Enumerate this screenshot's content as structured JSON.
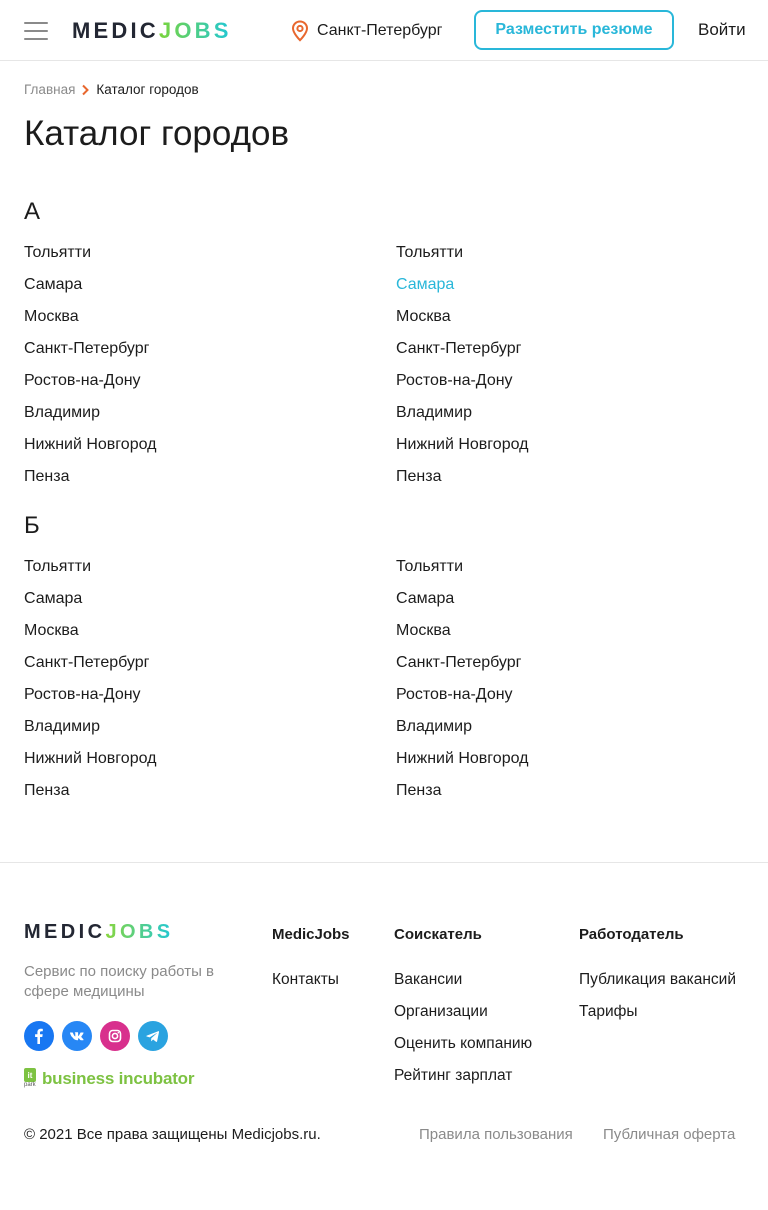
{
  "header": {
    "logo_part1": "MEDIC",
    "logo_part2": "JOBS",
    "city": "Санкт-Петербург",
    "resume_button": "Разместить резюме",
    "login": "Войти"
  },
  "breadcrumb": {
    "home": "Главная",
    "current": "Каталог городов"
  },
  "title": "Каталог городов",
  "sections": [
    {
      "letter": "А",
      "left": [
        "Тольятти",
        "Самара",
        "Москва",
        "Санкт-Петербург",
        "Ростов-на-Дону",
        "Владимир",
        "Нижний Новгород",
        "Пенза"
      ],
      "right": [
        "Тольятти",
        "Самара",
        "Москва",
        "Санкт-Петербург",
        "Ростов-на-Дону",
        "Владимир",
        "Нижний Новгород",
        "Пенза"
      ]
    },
    {
      "letter": "Б",
      "left": [
        "Тольятти",
        "Самара",
        "Москва",
        "Санкт-Петербург",
        "Ростов-на-Дону",
        "Владимир",
        "Нижний Новгород",
        "Пенза"
      ],
      "right": [
        "Тольятти",
        "Самара",
        "Москва",
        "Санкт-Петербург",
        "Ростов-на-Дону",
        "Владимир",
        "Нижний Новгород",
        "Пенза"
      ]
    }
  ],
  "active_link_color": "#29b7d9",
  "footer": {
    "logo_part1": "MEDIC",
    "logo_part2": "JOBS",
    "tagline": "Сервис по поиску работы в сфере медицины",
    "socials": [
      "facebook-icon",
      "vk-icon",
      "instagram-icon",
      "telegram-icon"
    ],
    "incubator": "business incubator",
    "incubator_mark": "it",
    "incubator_mark_sub": "park",
    "col_medicjobs": {
      "title": "MedicJobs",
      "links": [
        "Контакты"
      ]
    },
    "col_seeker": {
      "title": "Соискатель",
      "links": [
        "Вакансии",
        "Организации",
        "Оценить компанию",
        "Рейтинг зарплат"
      ]
    },
    "col_employer": {
      "title": "Работодатель",
      "links": [
        "Публикация вакансий",
        "Тарифы"
      ]
    },
    "copyright": "© 2021 Все права защищены Medicjobs.ru.",
    "terms": "Правила пользования",
    "offer": "Публичная оферта"
  }
}
